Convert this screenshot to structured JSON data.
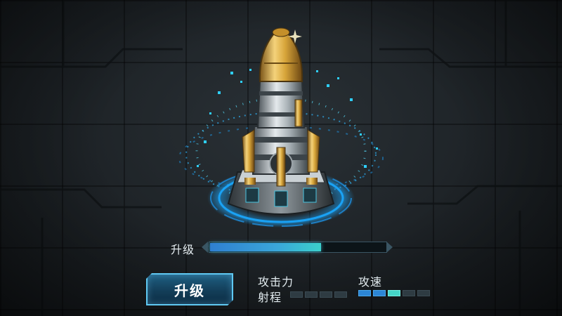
{
  "progress": {
    "label": "升级",
    "value": 0.63
  },
  "buttons": {
    "upgrade_label": "升级"
  },
  "stats": [
    {
      "label": "攻击力",
      "filled": 0,
      "segments": 4
    },
    {
      "label": "射程",
      "filled": 0,
      "segments": 4
    },
    {
      "label": "攻速",
      "filled": 2,
      "highlight": 1,
      "segments": 5
    }
  ],
  "colors": {
    "accent": "#3aa6d9",
    "gold": "#d7a53a",
    "glow": "#2fd0ff"
  }
}
